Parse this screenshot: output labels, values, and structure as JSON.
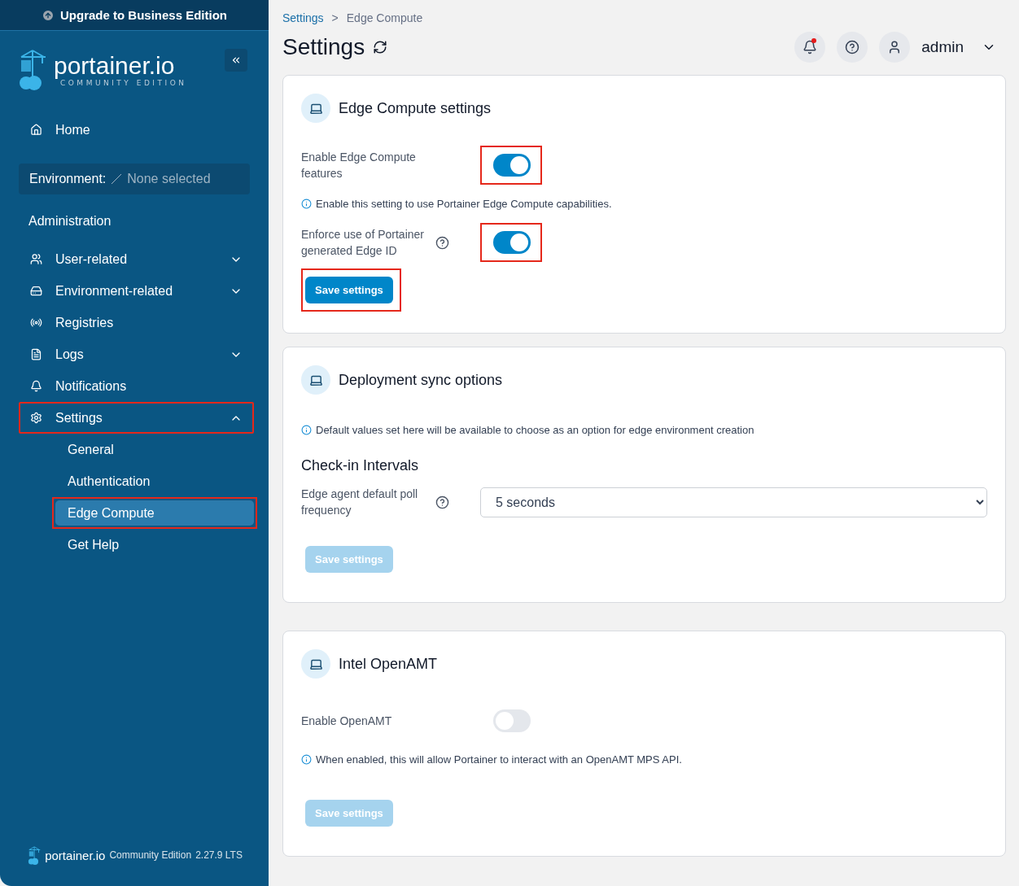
{
  "sidebar": {
    "upgrade_banner": "Upgrade to Business Edition",
    "logo": {
      "name": "portainer.io",
      "edition": "COMMUNITY EDITION"
    },
    "home": "Home",
    "environment": {
      "label": "Environment:",
      "value": "None selected"
    },
    "section_title": "Administration",
    "items": [
      {
        "kind": "users",
        "label": "User-related",
        "expanded": false,
        "highlighted": false
      },
      {
        "kind": "drive",
        "label": "Environment-related",
        "expanded": false,
        "highlighted": false
      },
      {
        "kind": "radio",
        "label": "Registries",
        "highlighted": false
      },
      {
        "kind": "file",
        "label": "Logs",
        "expanded": false,
        "highlighted": false
      },
      {
        "kind": "bell",
        "label": "Notifications",
        "highlighted": false
      },
      {
        "kind": "gear",
        "label": "Settings",
        "expanded": true,
        "highlighted": true,
        "children": [
          {
            "label": "General",
            "selected": false,
            "highlighted": false
          },
          {
            "label": "Authentication",
            "selected": false,
            "highlighted": false
          },
          {
            "label": "Edge Compute",
            "selected": true,
            "highlighted": true
          },
          {
            "label": "Get Help",
            "selected": false,
            "highlighted": false
          }
        ]
      }
    ],
    "footer": {
      "name": "portainer.io",
      "edition": "Community Edition",
      "version": "2.27.9 LTS"
    }
  },
  "header": {
    "breadcrumb": [
      {
        "label": "Settings",
        "link": true
      },
      {
        "label": "Edge Compute",
        "link": false
      }
    ],
    "separator": ">",
    "title": "Settings",
    "unread_notifications": true,
    "user": "admin"
  },
  "cards": [
    {
      "title": "Edge Compute settings",
      "fields": [
        {
          "kind": "toggle",
          "label": "Enable Edge Compute features",
          "on": true,
          "help": false,
          "highlighted": true
        },
        {
          "kind": "info",
          "text": "Enable this setting to use Portainer Edge Compute capabilities."
        },
        {
          "kind": "toggle",
          "label": "Enforce use of Portainer generated Edge ID",
          "on": true,
          "help": true,
          "highlighted": true
        }
      ],
      "button": {
        "label": "Save settings",
        "disabled": false,
        "highlighted": true
      }
    },
    {
      "title": "Deployment sync options",
      "fields": [
        {
          "kind": "info",
          "text": "Default values set here will be available to choose as an option for edge environment creation"
        },
        {
          "kind": "subheading",
          "text": "Check-in Intervals"
        },
        {
          "kind": "select",
          "label": "Edge agent default poll frequency",
          "value": "5 seconds",
          "help": true
        }
      ],
      "button": {
        "label": "Save settings",
        "disabled": true,
        "highlighted": false
      }
    },
    {
      "title": "Intel OpenAMT",
      "fields": [
        {
          "kind": "toggle",
          "label": "Enable OpenAMT",
          "on": false,
          "help": false,
          "highlighted": false
        },
        {
          "kind": "info",
          "text": "When enabled, this will allow Portainer to interact with an OpenAMT MPS API."
        }
      ],
      "button": {
        "label": "Save settings",
        "disabled": true,
        "highlighted": false
      }
    }
  ]
}
